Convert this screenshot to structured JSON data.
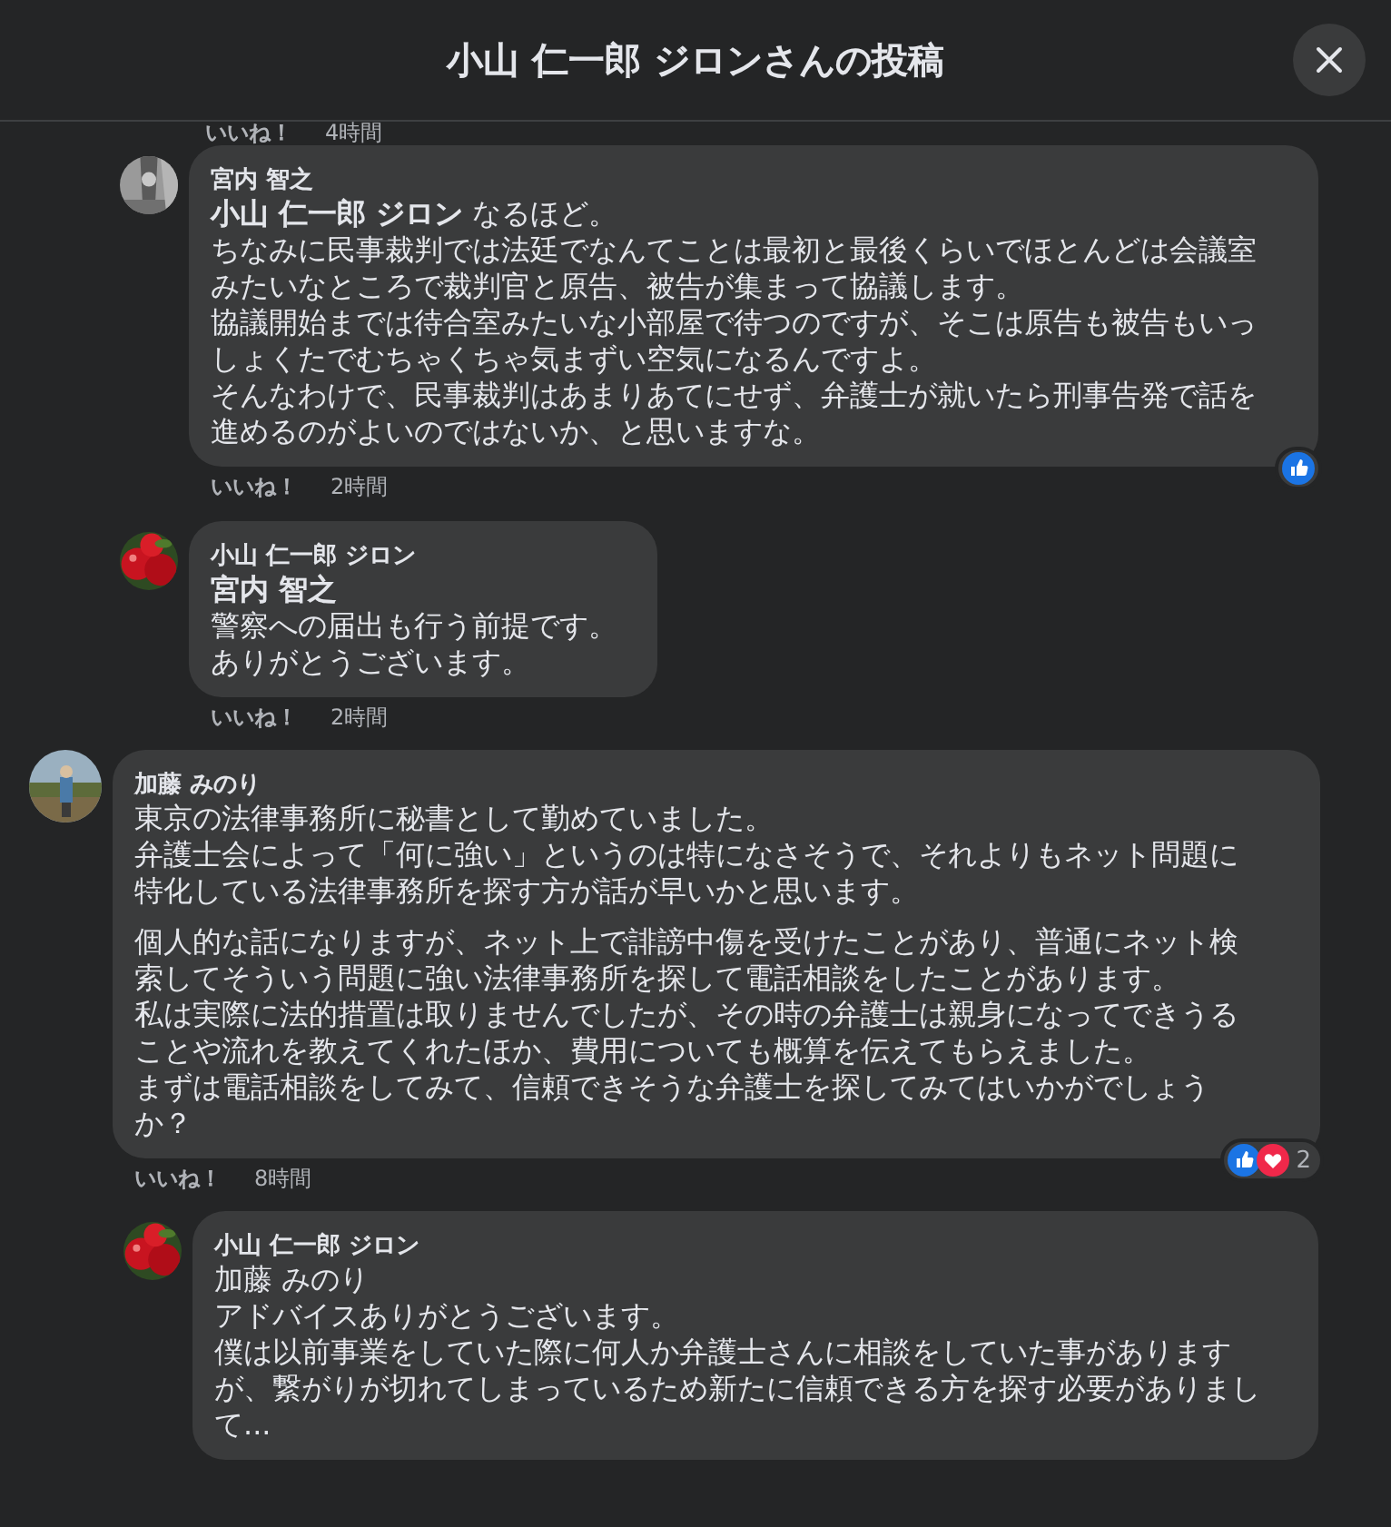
{
  "header": {
    "title": "小山 仁一郎 ジロンさんの投稿"
  },
  "earlier_reply_actions": {
    "like": "いいね！",
    "time": "4時間"
  },
  "replies_above": [
    {
      "author": "宮内 智之",
      "avatar": {
        "kind": "picture"
      },
      "paragraphs": [
        [
          "**小山 仁一郎 ジロン** なるほど。",
          "ちなみに民事裁判では法廷でなんてことは最初と最後くらいでほとんどは会議室みたいなところで裁判官と原告、被告が集まって協議します。",
          "協議開始までは待合室みたいな小部屋で待つのですが、そこは原告も被告もいっしょくたでむちゃくちゃ気まずい空気になるんですよ。",
          "そんなわけで、民事裁判はあまりあてにせず、弁護士が就いたら刑事告発で話を進めるのがよいのではないか、と思いますな。"
        ]
      ],
      "like": "いいね！",
      "time": "2時間",
      "reactions": [
        {
          "kind": "like"
        }
      ]
    },
    {
      "author": "小山 仁一郎 ジロン",
      "avatar": {
        "kind": "picture"
      },
      "paragraphs": [
        [
          "**宮内 智之**",
          "警察への届出も行う前提です。",
          "ありがとうございます。"
        ]
      ],
      "like": "いいね！",
      "time": "2時間"
    }
  ],
  "comments": [
    {
      "author": "加藤 みのり",
      "avatar": {
        "kind": "picture"
      },
      "paragraphs": [
        [
          "東京の法律事務所に秘書として勤めていました。",
          "弁護士会によって「何に強い」というのは特になさそうで、それよりもネット問題に特化している法律事務所を探す方が話が早いかと思います。"
        ],
        [
          "個人的な話になりますが、ネット上で誹謗中傷を受けたことがあり、普通にネット検索してそういう問題に強い法律事務所を探して電話相談をしたことがあります。",
          "私は実際に法的措置は取りませんでしたが、その時の弁護士は親身になってできうることや流れを教えてくれたほか、費用についても概算を伝えてもらえました。",
          "まずは電話相談をしてみて、信頼できそうな弁護士を探してみてはいかがでしょうか？"
        ]
      ],
      "like": "いいね！",
      "time": "8時間",
      "reactions": [
        {
          "kind": "like"
        },
        {
          "kind": "love"
        }
      ],
      "reaction_count": "2",
      "children": [
        {
          "author": "小山 仁一郎 ジロン",
          "avatar": {
            "kind": "picture"
          },
          "paragraphs": [
            [
              "加藤 みのり",
              "アドバイスありがとうございます。",
              "僕は以前事業をしていた際に何人か弁護士さんに相談をしていた事がありますが、繋がりが切れてしまっているため新たに信頼できる方を探す必要がありまして..."
            ]
          ]
        }
      ]
    }
  ]
}
